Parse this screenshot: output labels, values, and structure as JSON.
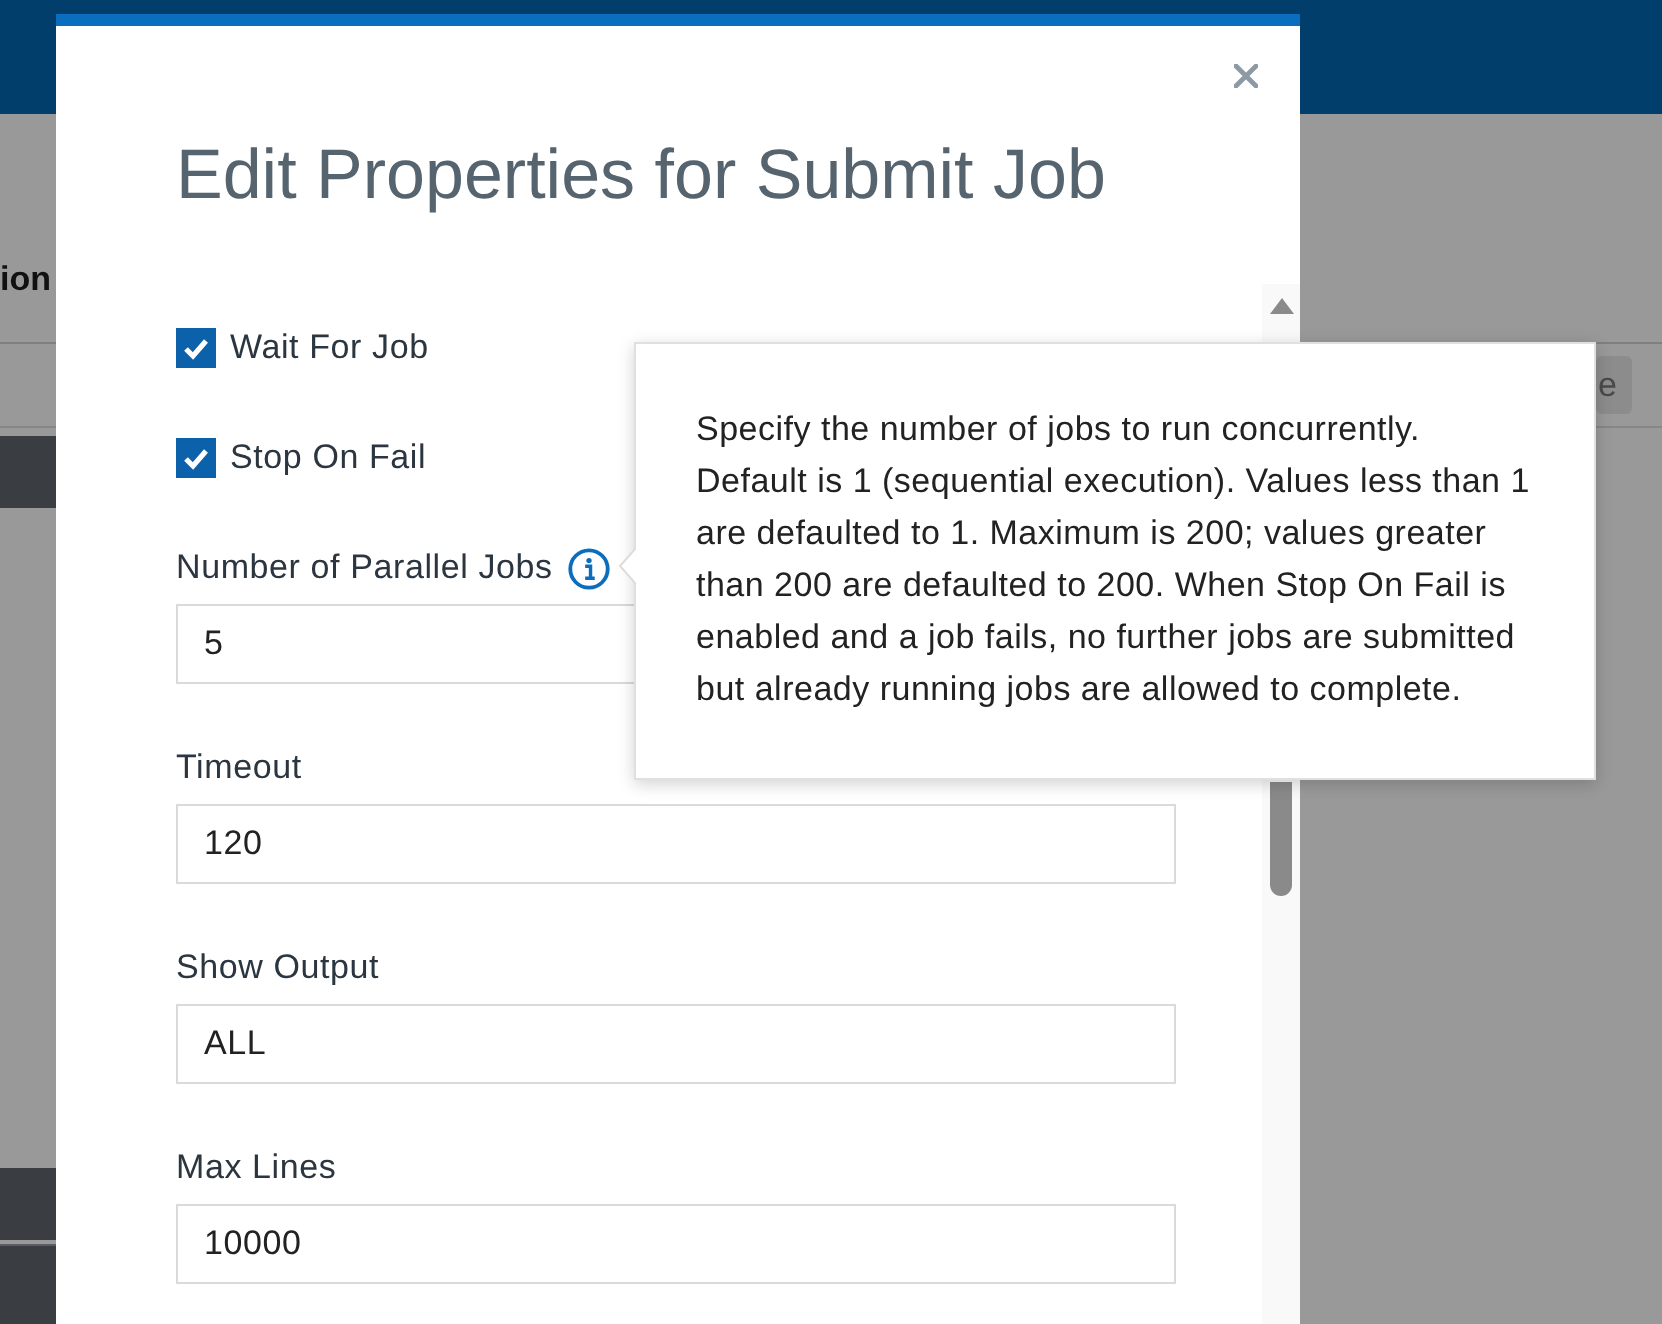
{
  "background": {
    "heading": "ion",
    "toolbar_button": "e"
  },
  "dialog": {
    "title": "Edit Properties for Submit Job",
    "fields": [
      {
        "kind": "checkbox",
        "label": "Wait For Job",
        "checked": true,
        "info": false
      },
      {
        "kind": "checkbox",
        "label": "Stop On Fail",
        "checked": true,
        "info": false
      },
      {
        "kind": "text",
        "label": "Number of Parallel Jobs",
        "value": "5",
        "info": true
      },
      {
        "kind": "text",
        "label": "Timeout",
        "value": "120",
        "info": false
      },
      {
        "kind": "text",
        "label": "Show Output",
        "value": "ALL",
        "info": false
      },
      {
        "kind": "text",
        "label": "Max Lines",
        "value": "10000",
        "info": false
      }
    ]
  },
  "tooltip": {
    "text": "Specify the number of jobs to run concurrently. Default is 1 (sequential execution). Values less than 1 are defaulted to 1. Maximum is 200; values greater than 200 are defaulted to 200. When Stop On Fail is enabled and a job fails, no further jobs are submitted but already running jobs are allowed to complete."
  }
}
